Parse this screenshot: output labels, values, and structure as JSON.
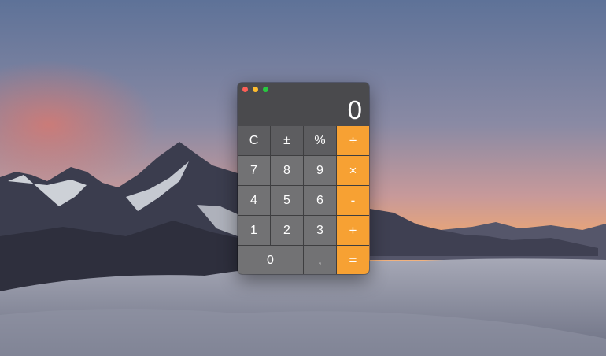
{
  "colors": {
    "operator": "#f7a133",
    "function_key": "#5d5d60",
    "number_key": "#727274",
    "display_bg": "#4a4a4d",
    "close": "#fe5f57",
    "minimize": "#febc2e",
    "zoom": "#28c840"
  },
  "display": {
    "value": "0"
  },
  "keys": {
    "clear": "C",
    "sign": "±",
    "percent": "%",
    "divide": "÷",
    "seven": "7",
    "eight": "8",
    "nine": "9",
    "multiply": "×",
    "four": "4",
    "five": "5",
    "six": "6",
    "subtract": "-",
    "one": "1",
    "two": "2",
    "three": "3",
    "add": "+",
    "zero": "0",
    "decimal": ",",
    "equals": "="
  }
}
